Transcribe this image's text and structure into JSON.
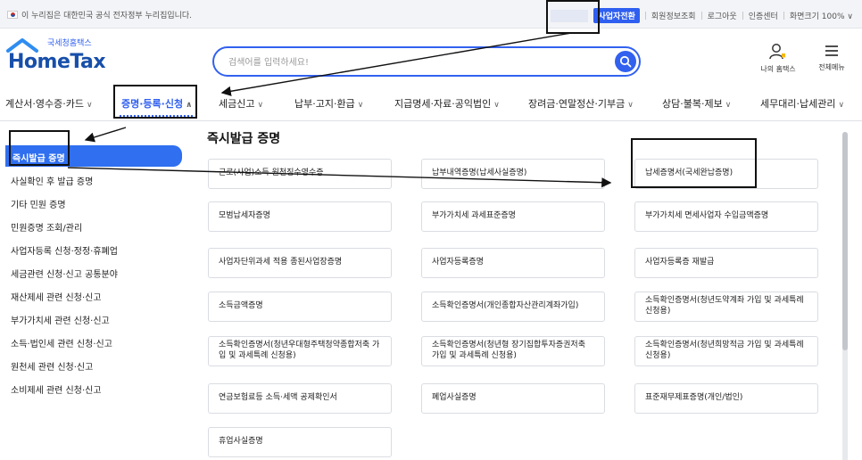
{
  "topbar": {
    "gov_notice": "이 누리집은 대한민국 공식 전자정부 누리집입니다.",
    "links": [
      "사업자전환",
      "회원정보조회",
      "로그아웃",
      "인증센터",
      "화면크기 100% ∨"
    ]
  },
  "header": {
    "logo_sub": "국세청홈택스",
    "logo_main": "HomeTax",
    "search_placeholder": "검색어를 입력하세요!",
    "myhome_label": "나의 홈택스",
    "menu_all_label": "전체메뉴"
  },
  "nav": {
    "items": [
      {
        "label": "계산서·영수증·카드",
        "chev": "∨"
      },
      {
        "label": "증명·등록·신청",
        "chev": "∧"
      },
      {
        "label": "세금신고",
        "chev": "∨"
      },
      {
        "label": "납부·고지·환급",
        "chev": "∨"
      },
      {
        "label": "지급명세·자료·공익법인",
        "chev": "∨"
      },
      {
        "label": "장려금·연말정산·기부금",
        "chev": "∨"
      },
      {
        "label": "상담·불복·제보",
        "chev": "∨"
      },
      {
        "label": "세무대리·납세관리",
        "chev": "∨"
      }
    ]
  },
  "sidebar": {
    "items": [
      "즉시발급 증명",
      "사실확인 후 발급 증명",
      "기타 민원 증명",
      "민원증명 조회/관리",
      "사업자등록 신청·정정·휴폐업",
      "세금관련 신청·신고 공통분야",
      "재산제세 관련 신청·신고",
      "부가가치세 관련 신청·신고",
      "소득·법인세 관련 신청·신고",
      "원천세 관련 신청·신고",
      "소비제세 관련 신청·신고"
    ]
  },
  "main": {
    "title": "즉시발급 증명",
    "certs": [
      "근로(사업)소득 원천징수영수증",
      "납부내역증명(납세사실증명)",
      "납세증명서(국세완납증명)",
      "모범납세자증명",
      "부가가치세 과세표준증명",
      "부가가치세 면세사업자 수입금액증명",
      "사업자단위과세 적용 종된사업장증명",
      "사업자등록증명",
      "사업자등록증 재발급",
      "소득금액증명",
      "소득확인증명서(개인종합자산관리계좌가입)",
      "소득확인증명서(청년도약계좌 가입 및 과세특례 신청용)",
      "소득확인증명서(청년우대형주택청약종합저축 가입 및 과세특례 신청용)",
      "소득확인증명서(청년형 장기집합투자증권저축 가입 및 과세특례 신청용)",
      "소득확인증명서(청년희망적금 가입 및 과세특례 신청용)",
      "연금보험료등 소득·세액 공제확인서",
      "폐업사실증명",
      "표준재무제표증명(개인/법인)",
      "휴업사실증명"
    ]
  },
  "colors": {
    "accent": "#2f5ff0",
    "sidebar_active": "#2f6ff0",
    "logo": "#174faa"
  }
}
